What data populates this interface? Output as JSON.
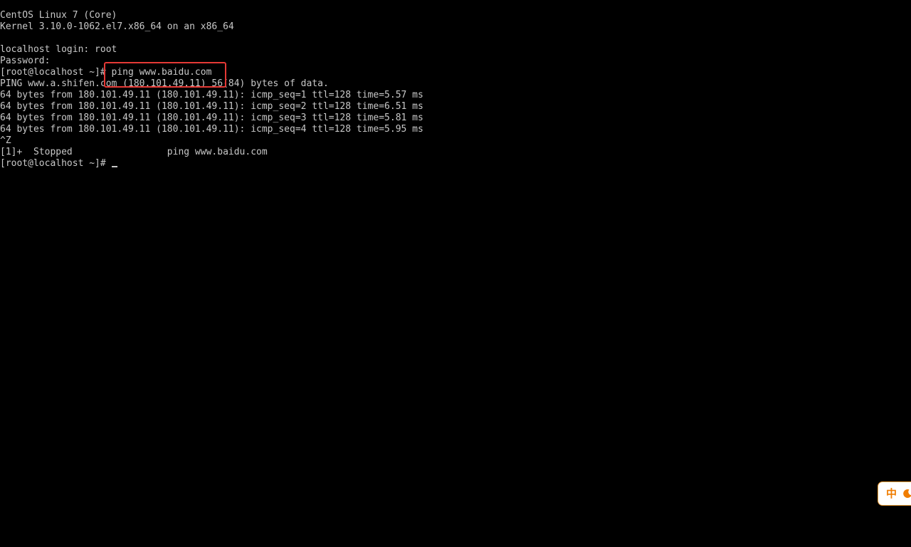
{
  "console": {
    "lines": [
      "CentOS Linux 7 (Core)",
      "Kernel 3.10.0-1062.el7.x86_64 on an x86_64",
      "",
      "localhost login: root",
      "Password:",
      "[root@localhost ~]# ping www.baidu.com",
      "PING www.a.shifen.com (180.101.49.11) 56(84) bytes of data.",
      "64 bytes from 180.101.49.11 (180.101.49.11): icmp_seq=1 ttl=128 time=5.57 ms",
      "64 bytes from 180.101.49.11 (180.101.49.11): icmp_seq=2 ttl=128 time=6.51 ms",
      "64 bytes from 180.101.49.11 (180.101.49.11): icmp_seq=3 ttl=128 time=5.81 ms",
      "64 bytes from 180.101.49.11 (180.101.49.11): icmp_seq=4 ttl=128 time=5.95 ms",
      "^Z",
      "[1]+  Stopped                 ping www.baidu.com"
    ],
    "prompt": "[root@localhost ~]# ",
    "text_color": "#c8c8c8",
    "background_color": "#000000"
  },
  "annotation": {
    "highlight_color": "#e53935"
  },
  "ime": {
    "mode_label": "中",
    "icon": "moon-icon",
    "accent_color": "#f07d00"
  }
}
